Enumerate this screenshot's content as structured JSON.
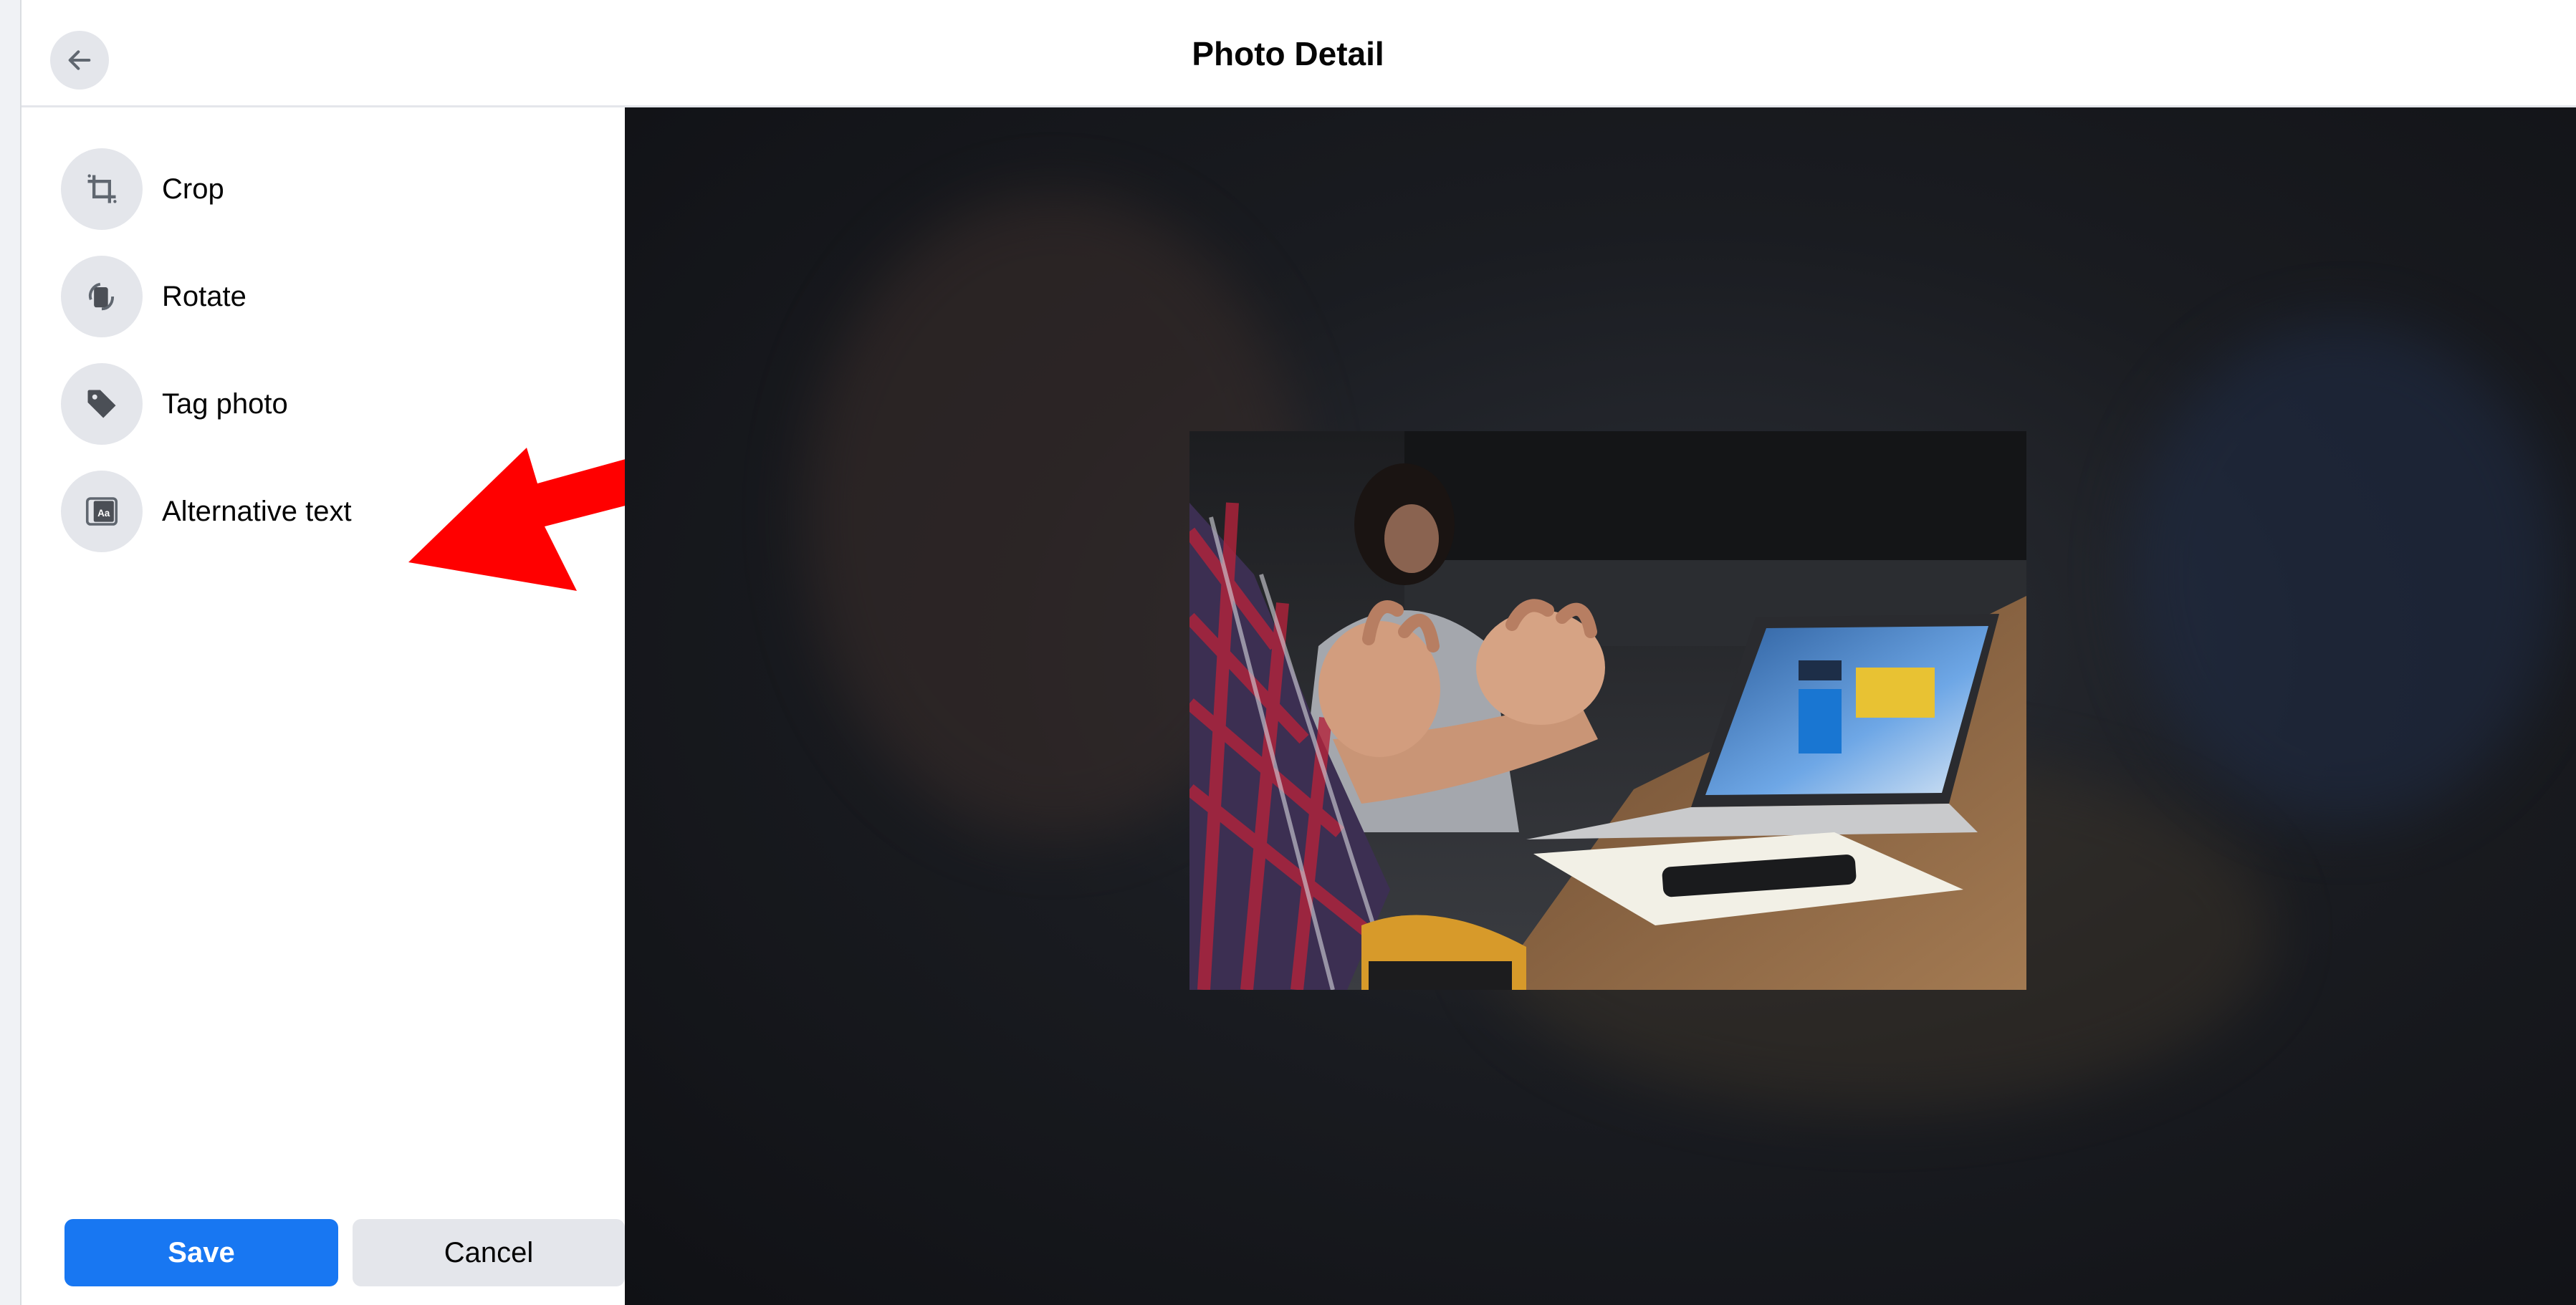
{
  "header": {
    "title": "Photo Detail",
    "back_icon": "arrow-left-icon"
  },
  "tools": [
    {
      "label": "Crop",
      "icon": "crop-icon"
    },
    {
      "label": "Rotate",
      "icon": "rotate-icon"
    },
    {
      "label": "Tag photo",
      "icon": "tag-icon"
    },
    {
      "label": "Alternative text",
      "icon": "alt-text-icon"
    }
  ],
  "footer": {
    "save_label": "Save",
    "cancel_label": "Cancel"
  },
  "annotation": {
    "arrow_color": "#ff0000",
    "points_to": "Alternative text"
  },
  "colors": {
    "primary": "#1877f2",
    "secondary_button": "#e4e6eb"
  }
}
